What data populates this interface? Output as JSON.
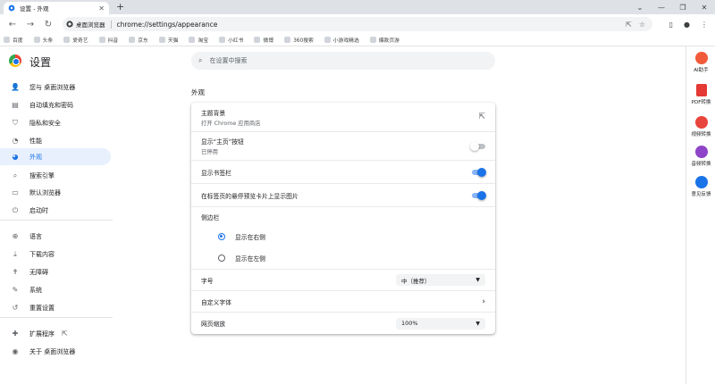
{
  "tab": {
    "title": "设置 - 外观"
  },
  "toolbar": {
    "site_chip": "桌面浏览器",
    "url": "chrome://settings/appearance"
  },
  "bookmarks": [
    "百度",
    "头条",
    "爱奇艺",
    "抖音",
    "京东",
    "天猫",
    "淘宝",
    "小红书",
    "微博",
    "360搜索",
    "小游戏精选",
    "爆款页游"
  ],
  "settings": {
    "title": "设置"
  },
  "nav": [
    {
      "label": "您与 桌面浏览器",
      "icon": "person-icon"
    },
    {
      "label": "自动填充和密码",
      "icon": "autofill-icon"
    },
    {
      "label": "隐私和安全",
      "icon": "shield-icon"
    },
    {
      "label": "性能",
      "icon": "speedometer-icon"
    },
    {
      "label": "外观",
      "icon": "palette-icon"
    },
    {
      "label": "搜索引擎",
      "icon": "search-icon"
    },
    {
      "label": "默认浏览器",
      "icon": "browser-icon"
    },
    {
      "label": "启动时",
      "icon": "power-icon"
    },
    {
      "label": "语言",
      "icon": "globe-icon"
    },
    {
      "label": "下载内容",
      "icon": "download-icon"
    },
    {
      "label": "无障碍",
      "icon": "accessibility-icon"
    },
    {
      "label": "系统",
      "icon": "wrench-icon"
    },
    {
      "label": "重置设置",
      "icon": "reset-icon"
    },
    {
      "label": "扩展程序",
      "icon": "puzzle-icon"
    },
    {
      "label": "关于 桌面浏览器",
      "icon": "about-icon"
    }
  ],
  "search": {
    "placeholder": "在设置中搜索"
  },
  "section": {
    "title": "外观"
  },
  "appearance": {
    "theme": {
      "title": "主题背景",
      "sub": "打开 Chrome 应用商店"
    },
    "home_button": {
      "title": "显示“主页”按钮",
      "sub": "已停用",
      "on": false
    },
    "bookmarks_bar": {
      "title": "显示书签栏",
      "on": true
    },
    "tab_hover": {
      "title": "在标签页的悬停预览卡片上显示图片",
      "on": true
    },
    "side_panel": {
      "title": "侧边栏",
      "options": [
        "显示在右侧",
        "显示在左侧"
      ],
      "selected": 0
    },
    "font_size": {
      "title": "字号",
      "value": "中（推荐）"
    },
    "custom_fonts": {
      "title": "自定义字体"
    },
    "page_zoom": {
      "title": "网页缩放",
      "value": "100%"
    }
  },
  "extensions": [
    {
      "label": "AI助手",
      "icon": "ai-assistant-icon",
      "color": "#f15a3a"
    },
    {
      "label": "PDF转换",
      "icon": "pdf-icon",
      "color": "#e53935"
    },
    {
      "label": "视频转换",
      "icon": "video-convert-icon",
      "color": "#e8453c"
    },
    {
      "label": "音频转换",
      "icon": "audio-convert-icon",
      "color": "#8e44c9"
    },
    {
      "label": "意见反馈",
      "icon": "feedback-icon",
      "color": "#1a73e8"
    }
  ],
  "colors": {
    "accent": "#1a73e8",
    "nav_active_bg": "#e8f0fe"
  }
}
